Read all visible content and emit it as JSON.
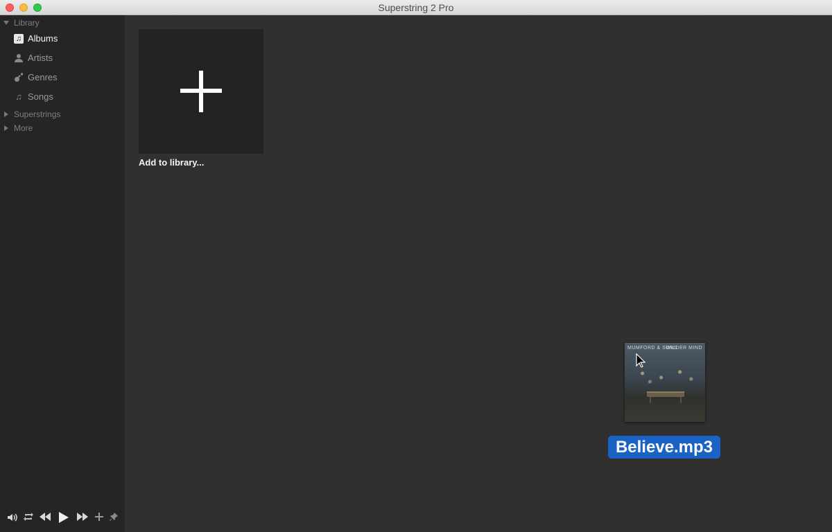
{
  "window": {
    "title": "Superstring 2 Pro"
  },
  "sidebar": {
    "library_label": "Library",
    "items": [
      {
        "label": "Albums",
        "icon": "music-note-icon",
        "active": true
      },
      {
        "label": "Artists",
        "icon": "person-icon",
        "active": false
      },
      {
        "label": "Genres",
        "icon": "guitar-icon",
        "active": false
      },
      {
        "label": "Songs",
        "icon": "music-note-icon",
        "active": false
      }
    ],
    "groups": [
      {
        "label": "Superstrings"
      },
      {
        "label": "More"
      }
    ]
  },
  "controls": [
    "volume-icon",
    "repeat-icon",
    "rewind-icon",
    "play-icon",
    "fast-forward-icon",
    "add-icon",
    "pin-icon"
  ],
  "main": {
    "add_tile_label": "Add to library..."
  },
  "drag": {
    "album_artist": "MUMFORD & SONS",
    "album_title": "WILDER MIND",
    "filename": "Believe.mp3"
  },
  "colors": {
    "accent": "#1a62c4",
    "sidebar_bg": "#252525",
    "main_bg": "#303030"
  }
}
